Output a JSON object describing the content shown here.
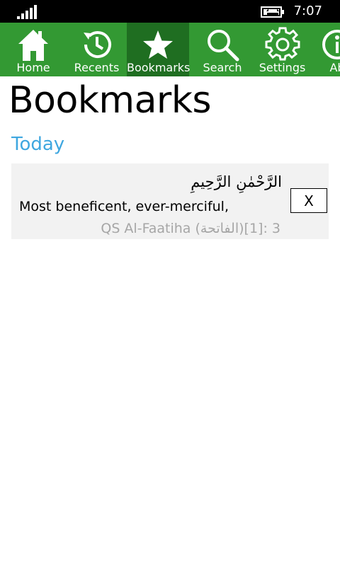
{
  "status_bar": {
    "time": "7:07",
    "icons": [
      "signal-strength-icon",
      "battery-charging-icon"
    ]
  },
  "nav": {
    "items": [
      {
        "label": "Home",
        "icon": "home-icon",
        "active": false
      },
      {
        "label": "Recents",
        "icon": "history-icon",
        "active": false
      },
      {
        "label": "Bookmarks",
        "icon": "star-icon",
        "active": true
      },
      {
        "label": "Search",
        "icon": "search-icon",
        "active": false
      },
      {
        "label": "Settings",
        "icon": "gear-icon",
        "active": false
      },
      {
        "label": "Ab",
        "icon": "info-icon",
        "active": false
      }
    ]
  },
  "page": {
    "title": "Bookmarks"
  },
  "groups": [
    {
      "header": "Today",
      "bookmarks": [
        {
          "arabic": "الرَّحْمٰنِ الرَّحِيمِ",
          "english": "Most beneficent, ever-merciful,",
          "reference": "QS Al-Faatiha (الفاتحة)[1]: 3",
          "delete_label": "X"
        }
      ]
    }
  ],
  "colors": {
    "nav_background": "#339933",
    "nav_active": "#1f6e21",
    "accent": "#3fa7e0",
    "card_background": "#f2f2f2",
    "reference_text": "#a6a6a6"
  }
}
